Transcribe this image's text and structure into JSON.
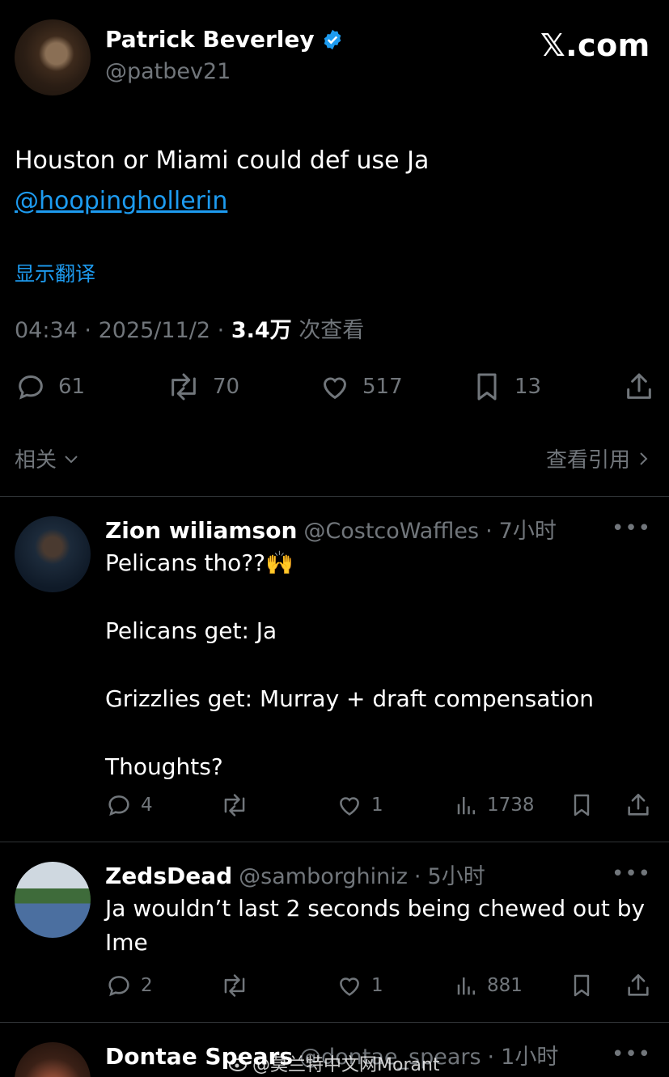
{
  "header": {
    "author_name": "Patrick Beverley",
    "author_handle": "@patbev21",
    "site_logo": "𝕏.com"
  },
  "tweet": {
    "line1": "Houston or Miami could def use Ja",
    "mention": "@hoopinghollerin",
    "translate_label": "显示翻译",
    "time": "04:34",
    "date": "2025/11/2",
    "views_count": "3.4万",
    "views_label": "次查看",
    "sep": "·"
  },
  "actions": {
    "replies": "61",
    "retweets": "70",
    "likes": "517",
    "bookmarks": "13"
  },
  "related": {
    "label": "相关",
    "quotes_label": "查看引用"
  },
  "replies": [
    {
      "name": "Zion wiliamson",
      "handle": "@CostcoWaffles",
      "time": "7小时",
      "text": "Pelicans tho??🙌\n\nPelicans get: Ja\n\nGrizzlies get: Murray + draft compensation\n\nThoughts?",
      "replies": "4",
      "likes": "1",
      "views": "1738"
    },
    {
      "name": "ZedsDead",
      "handle": "@samborghiniz",
      "time": "5小时",
      "text": "Ja wouldn’t last 2 seconds being chewed out by\nIme",
      "replies": "2",
      "likes": "1",
      "views": "881"
    },
    {
      "name": "Dontae Spears",
      "handle": "@dontae_spears",
      "time": "1小时"
    }
  ],
  "more_label": "•••",
  "watermark": "@莫兰特中文网Morant",
  "colors": {
    "background": "#000000",
    "link": "#1d9bf0",
    "muted": "#71767b",
    "verified": "#1d9bf0"
  }
}
